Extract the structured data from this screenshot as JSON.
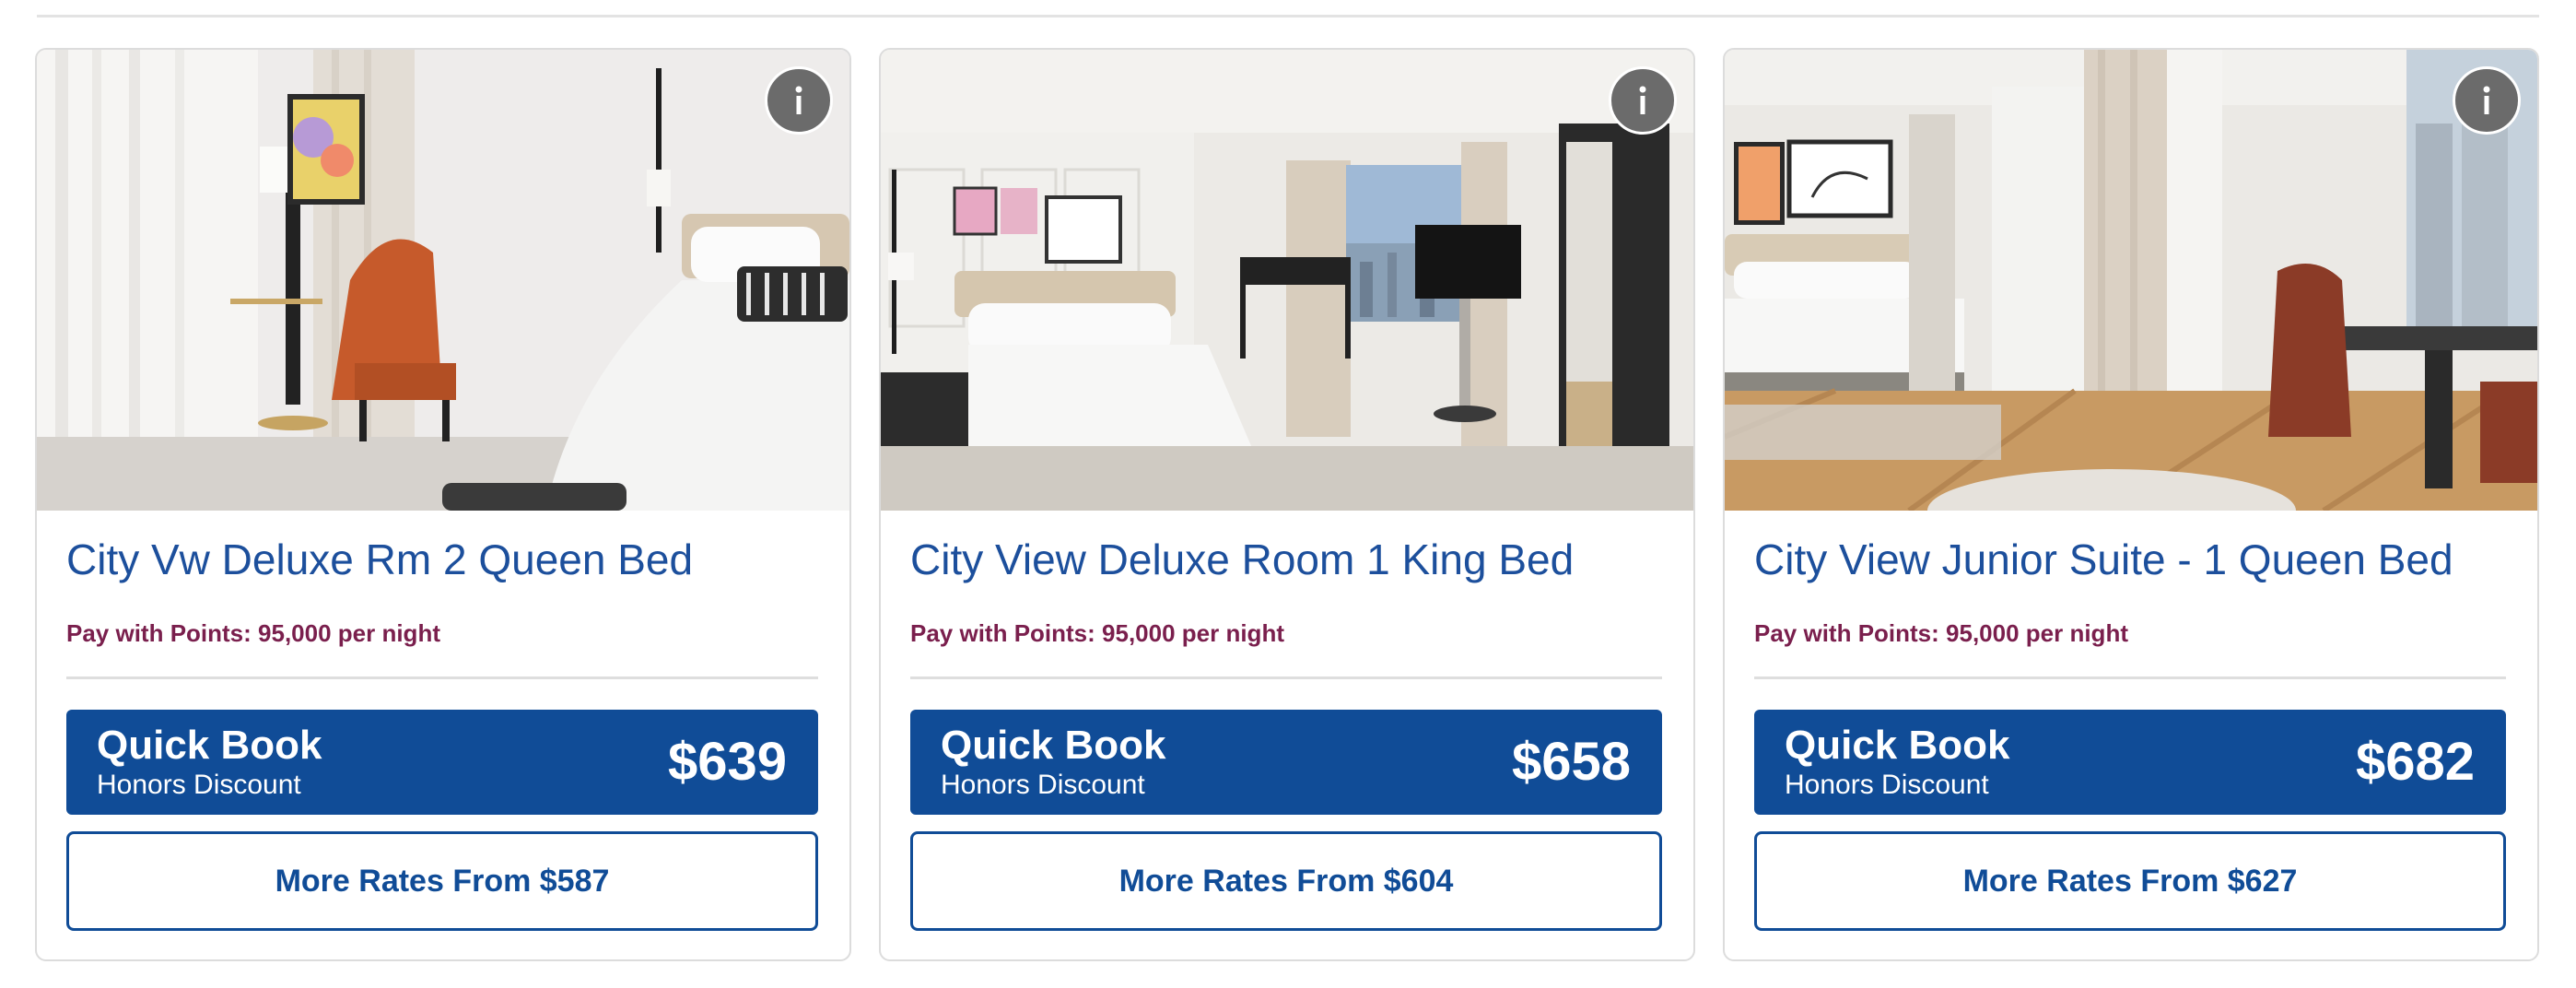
{
  "cards": [
    {
      "room_name": "City Vw Deluxe Rm 2 Queen Bed",
      "points_text": "Pay with Points: 95,000 per night",
      "quick_book_title": "Quick Book",
      "quick_book_subtitle": "Honors Discount",
      "quick_book_price": "$639",
      "more_rates_label": "More Rates From $587",
      "info_label": "i"
    },
    {
      "room_name": "City View Deluxe Room 1 King Bed",
      "points_text": "Pay with Points: 95,000 per night",
      "quick_book_title": "Quick Book",
      "quick_book_subtitle": "Honors Discount",
      "quick_book_price": "$658",
      "more_rates_label": "More Rates From $604",
      "info_label": "i"
    },
    {
      "room_name": "City View Junior Suite - 1 Queen Bed",
      "points_text": "Pay with Points: 95,000 per night",
      "quick_book_title": "Quick Book",
      "quick_book_subtitle": "Honors Discount",
      "quick_book_price": "$682",
      "more_rates_label": "More Rates From $627",
      "info_label": "i"
    }
  ],
  "colors": {
    "brand_blue": "#104c97",
    "title_blue": "#1c4f9c",
    "points_plum": "#7a1f4d",
    "info_gray": "#6b6b6b"
  },
  "icons": {
    "info": "info-icon"
  }
}
